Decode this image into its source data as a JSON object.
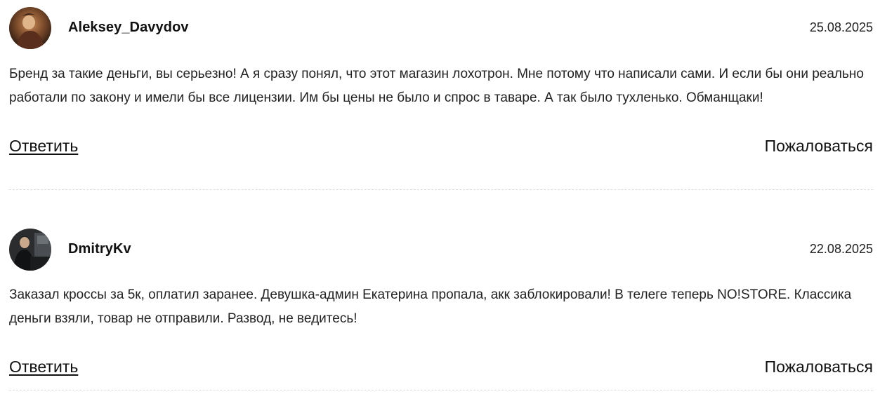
{
  "comments": [
    {
      "author": "Aleksey_Davydov",
      "date": "25.08.2025",
      "text": "Бренд за такие деньги, вы серьезно! А я сразу понял, что этот магазин лохотрон. Мне потому что написали сами. И если бы они реально работали по закону и имели бы все лицензии. Им бы цены не было и спрос в таваре. А так было тухленько. Обманщаки!",
      "reply_label": "Ответить",
      "report_label": "Пожаловаться"
    },
    {
      "author": "DmitryKv",
      "date": "22.08.2025",
      "text": "Заказал кроссы за 5к, оплатил заранее. Девушка-админ Екатерина пропала, акк заблокировали! В телеге теперь NO!STORE. Классика деньги взяли, товар не отправили. Развод, не ведитесь!",
      "reply_label": "Ответить",
      "report_label": "Пожаловаться"
    }
  ]
}
